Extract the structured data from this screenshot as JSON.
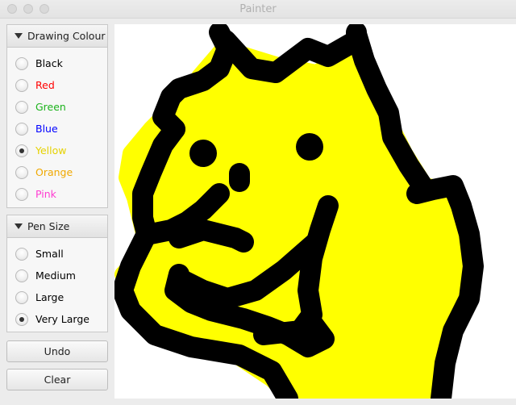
{
  "window": {
    "title": "Painter"
  },
  "drawing_colour": {
    "header": "Drawing Colour",
    "options": [
      {
        "label": "Black",
        "color": "#000000",
        "selected": false
      },
      {
        "label": "Red",
        "color": "#ff0000",
        "selected": false
      },
      {
        "label": "Green",
        "color": "#1db31d",
        "selected": false
      },
      {
        "label": "Blue",
        "color": "#0000ff",
        "selected": false
      },
      {
        "label": "Yellow",
        "color": "#e6d200",
        "selected": true
      },
      {
        "label": "Orange",
        "color": "#f0a800",
        "selected": false
      },
      {
        "label": "Pink",
        "color": "#ff3bd1",
        "selected": false
      }
    ]
  },
  "pen_size": {
    "header": "Pen Size",
    "options": [
      {
        "label": "Small",
        "selected": false
      },
      {
        "label": "Medium",
        "selected": false
      },
      {
        "label": "Large",
        "selected": false
      },
      {
        "label": "Very Large",
        "selected": true
      }
    ]
  },
  "buttons": {
    "undo": "Undo",
    "clear": "Clear"
  },
  "canvas_colors": {
    "background": "#ffffff",
    "fill": "#ffff00",
    "stroke": "#000000"
  }
}
